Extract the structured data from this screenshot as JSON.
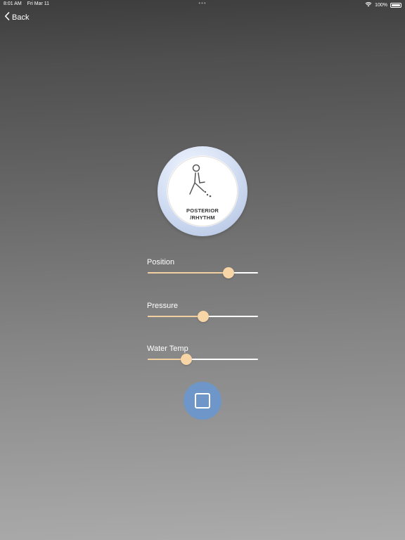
{
  "status_bar": {
    "time": "8:01 AM",
    "date": "Fri Mar 11",
    "center_dots": "•••",
    "battery": "100%",
    "icons": [
      "wifi-icon",
      "battery-icon"
    ]
  },
  "nav": {
    "back_label": "Back",
    "back_icon": "chevron-left-icon"
  },
  "mode": {
    "line1": "POSTERIOR",
    "line2": "/RHYTHM",
    "icon": "seated-person-spray-icon"
  },
  "sliders": [
    {
      "label": "Position",
      "value": 0.73
    },
    {
      "label": "Pressure",
      "value": 0.5
    },
    {
      "label": "Water Temp",
      "value": 0.35
    }
  ],
  "stop_button": {
    "icon": "stop-icon"
  },
  "colors": {
    "accent_fill": "#f2cfa0",
    "thumb": "#f7d5a6",
    "stop_button": "#6f96c9",
    "dial_ring": "#c9d6ef"
  }
}
